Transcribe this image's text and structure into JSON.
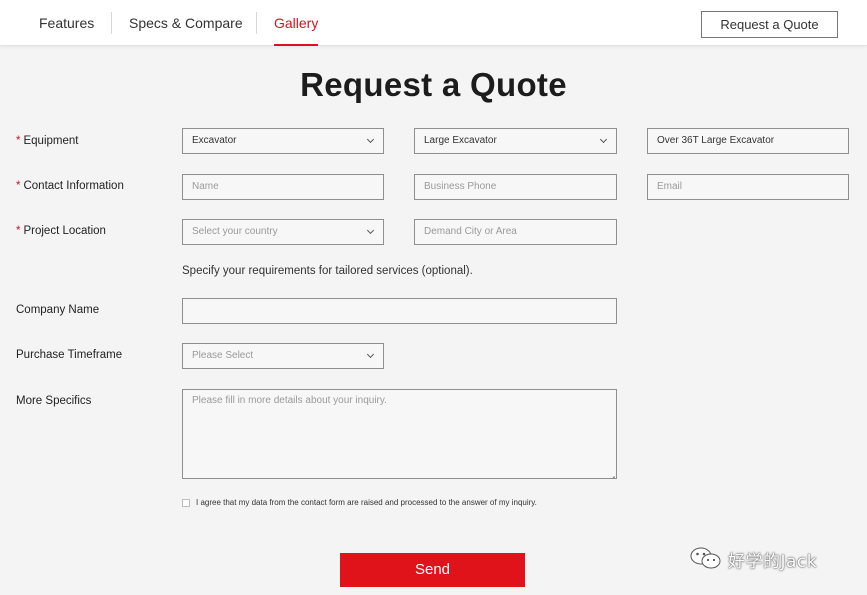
{
  "nav": {
    "tabs": [
      "Features",
      "Specs & Compare",
      "Gallery"
    ],
    "active_tab": "Gallery",
    "quote_button": "Request a Quote"
  },
  "page_title": "Request a Quote",
  "form": {
    "equipment": {
      "label": "Equipment",
      "required_mark": "*",
      "type_value": "Excavator",
      "size_value": "Large Excavator",
      "model_value": "Over 36T Large Excavator"
    },
    "contact": {
      "label": "Contact Information",
      "required_mark": "*",
      "name_placeholder": "Name",
      "phone_placeholder": "Business Phone",
      "email_placeholder": "Email"
    },
    "location": {
      "label": "Project Location",
      "required_mark": "*",
      "country_placeholder": "Select your country",
      "city_placeholder": "Demand City or Area"
    },
    "optional_note": "Specify your requirements for tailored services (optional).",
    "company": {
      "label": "Company Name",
      "value": ""
    },
    "timeframe": {
      "label": "Purchase Timeframe",
      "placeholder": "Please Select"
    },
    "specifics": {
      "label": "More Specifics",
      "placeholder": "Please fill in more details about your inquiry."
    },
    "consent_text": "I agree that my data from the contact form are raised and processed to the answer of my inquiry.",
    "send_label": "Send"
  },
  "watermark": {
    "text": "好学的Jack",
    "icon": "wechat-icon"
  },
  "colors": {
    "accent": "#e0131b",
    "background": "#f4f4f4"
  }
}
